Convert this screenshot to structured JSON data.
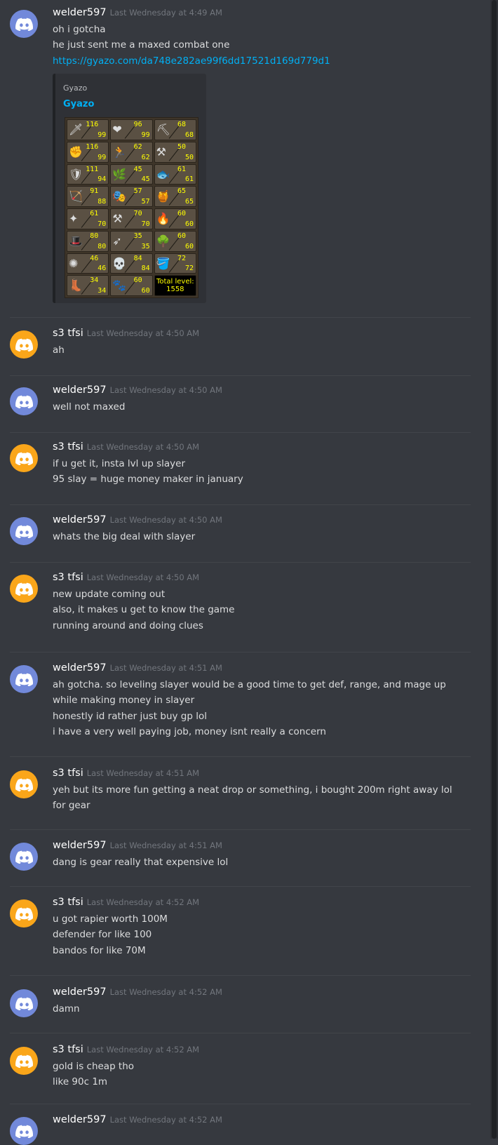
{
  "messages": [
    {
      "user": "welder597",
      "time": "Last Wednesday at 4:49 AM",
      "avatar": "blue",
      "lines": [
        "oh i gotcha",
        "he just sent me a maxed combat one"
      ],
      "link": "https://gyazo.com/da748e282ae99f6dd17521d169d779d1"
    },
    {
      "user": "s3 tfsi",
      "time": "Last Wednesday at 4:50 AM",
      "avatar": "orange",
      "lines": [
        "ah"
      ]
    },
    {
      "user": "welder597",
      "time": "Last Wednesday at 4:50 AM",
      "avatar": "blue",
      "lines": [
        "well not maxed"
      ]
    },
    {
      "user": "s3 tfsi",
      "time": "Last Wednesday at 4:50 AM",
      "avatar": "orange",
      "lines": [
        "if u get it, insta lvl up slayer",
        "95 slay = huge money maker in january"
      ]
    },
    {
      "user": "welder597",
      "time": "Last Wednesday at 4:50 AM",
      "avatar": "blue",
      "lines": [
        "whats the big deal with slayer"
      ]
    },
    {
      "user": "s3 tfsi",
      "time": "Last Wednesday at 4:50 AM",
      "avatar": "orange",
      "lines": [
        "new update coming out",
        "also, it makes u get to know the game",
        "running around and doing clues"
      ]
    },
    {
      "user": "welder597",
      "time": "Last Wednesday at 4:51 AM",
      "avatar": "blue",
      "lines": [
        "ah gotcha. so leveling slayer would be a good time to get def, range, and mage up",
        "while making money in slayer",
        "honestly id rather just buy gp lol",
        "i have a very well paying job, money isnt really a concern"
      ]
    },
    {
      "user": "s3 tfsi",
      "time": "Last Wednesday at 4:51 AM",
      "avatar": "orange",
      "lines": [
        "yeh but its more fun getting a neat drop or something, i bought 200m right away lol",
        "for gear"
      ]
    },
    {
      "user": "welder597",
      "time": "Last Wednesday at 4:51 AM",
      "avatar": "blue",
      "lines": [
        "dang is gear really that expensive lol"
      ]
    },
    {
      "user": "s3 tfsi",
      "time": "Last Wednesday at 4:52 AM",
      "avatar": "orange",
      "lines": [
        "u got rapier worth 100M",
        "defender for like 100",
        "bandos for like 70M"
      ]
    },
    {
      "user": "welder597",
      "time": "Last Wednesday at 4:52 AM",
      "avatar": "blue",
      "lines": [
        "damn"
      ]
    },
    {
      "user": "s3 tfsi",
      "time": "Last Wednesday at 4:52 AM",
      "avatar": "orange",
      "lines": [
        "gold is cheap tho",
        "like 90c 1m"
      ]
    },
    {
      "user": "welder597",
      "time": "Last Wednesday at 4:52 AM",
      "avatar": "blue",
      "lines": []
    }
  ],
  "embed": {
    "provider": "Gyazo",
    "title": "Gyazo",
    "skills": [
      {
        "icon": "sword-icon",
        "glyph": "🗡",
        "cur": "116",
        "max": "99"
      },
      {
        "icon": "heart-icon",
        "glyph": "❤",
        "cur": "96",
        "max": "99"
      },
      {
        "icon": "pickaxe-icon",
        "glyph": "⛏",
        "cur": "68",
        "max": "68"
      },
      {
        "icon": "fist-icon",
        "glyph": "✊",
        "cur": "116",
        "max": "99"
      },
      {
        "icon": "agility-icon",
        "glyph": "🏃",
        "cur": "62",
        "max": "62"
      },
      {
        "icon": "anvil-icon",
        "glyph": "⚒",
        "cur": "50",
        "max": "50"
      },
      {
        "icon": "shield-icon",
        "glyph": "🛡",
        "cur": "111",
        "max": "94"
      },
      {
        "icon": "herb-icon",
        "glyph": "🌿",
        "cur": "45",
        "max": "45"
      },
      {
        "icon": "fish-icon",
        "glyph": "🐟",
        "cur": "61",
        "max": "61"
      },
      {
        "icon": "bow-icon",
        "glyph": "🏹",
        "cur": "91",
        "max": "88"
      },
      {
        "icon": "mask-icon",
        "glyph": "🎭",
        "cur": "57",
        "max": "57"
      },
      {
        "icon": "pot-icon",
        "glyph": "🍯",
        "cur": "65",
        "max": "65"
      },
      {
        "icon": "prayer-icon",
        "glyph": "✦",
        "cur": "61",
        "max": "70"
      },
      {
        "icon": "crafting-icon",
        "glyph": "⚒",
        "cur": "70",
        "max": "70"
      },
      {
        "icon": "fire-icon",
        "glyph": "🔥",
        "cur": "60",
        "max": "60"
      },
      {
        "icon": "wizard-hat-icon",
        "glyph": "🎩",
        "cur": "80",
        "max": "80"
      },
      {
        "icon": "fletching-icon",
        "glyph": "➶",
        "cur": "35",
        "max": "35"
      },
      {
        "icon": "tree-icon",
        "glyph": "🌳",
        "cur": "60",
        "max": "60"
      },
      {
        "icon": "runecraft-icon",
        "glyph": "✺",
        "cur": "46",
        "max": "46"
      },
      {
        "icon": "slayer-skull-icon",
        "glyph": "💀",
        "cur": "84",
        "max": "84"
      },
      {
        "icon": "watering-can-icon",
        "glyph": "🪣",
        "cur": "72",
        "max": "72"
      },
      {
        "icon": "boot-icon",
        "glyph": "👢",
        "cur": "34",
        "max": "34"
      },
      {
        "icon": "paw-icon",
        "glyph": "🐾",
        "cur": "60",
        "max": "60"
      }
    ],
    "total_label": "Total level:",
    "total_value": "1558"
  }
}
